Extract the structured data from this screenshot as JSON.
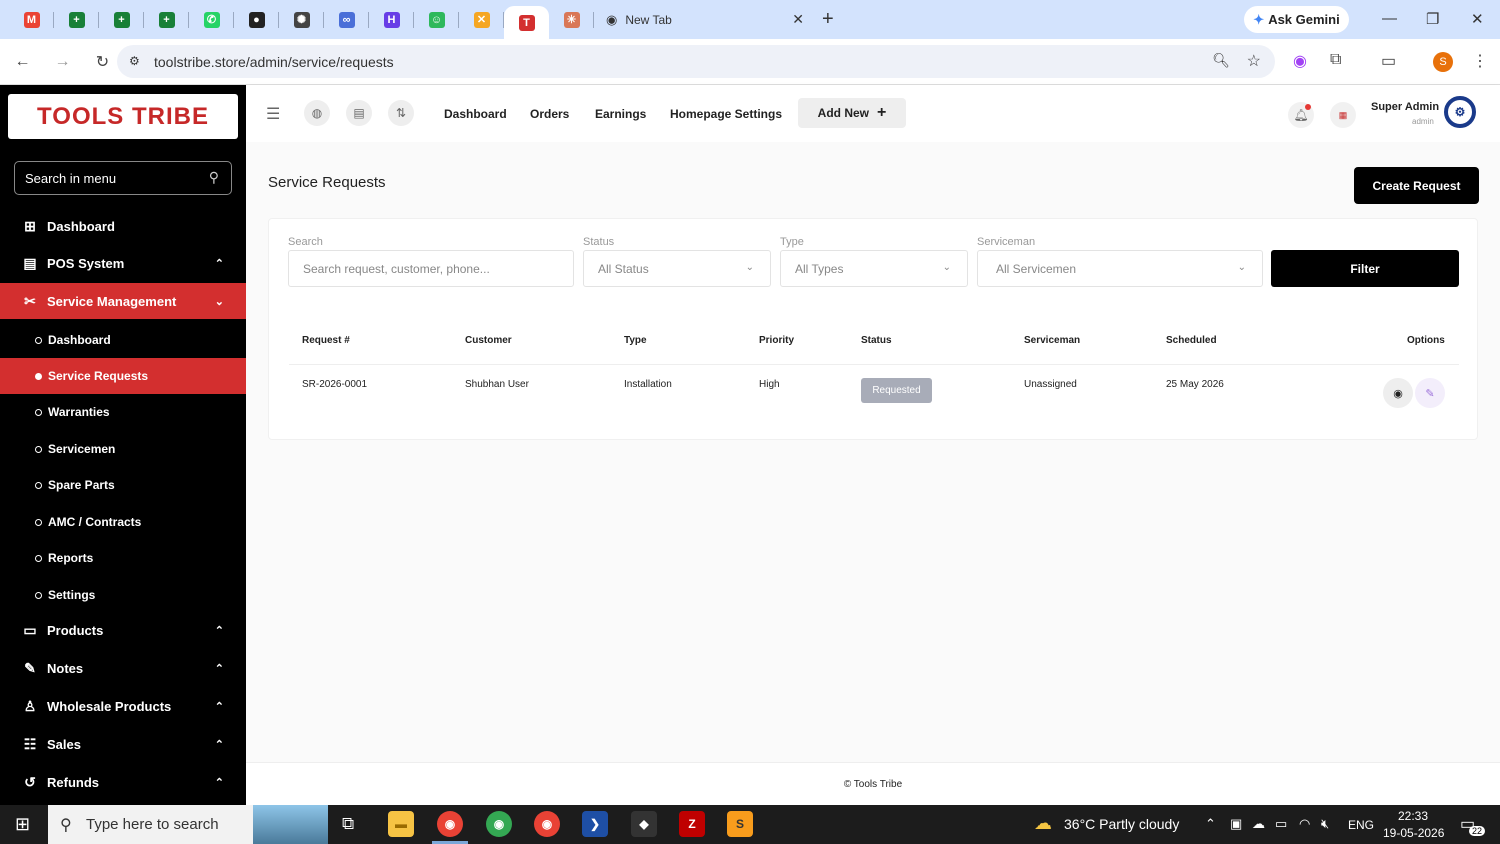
{
  "browser": {
    "tabs": [
      {
        "name": "gmail-tab",
        "glyph": "M",
        "color": "#ea4335"
      },
      {
        "name": "sheets-tab-1",
        "glyph": "+",
        "color": "#188038"
      },
      {
        "name": "sheets-tab-2",
        "glyph": "+",
        "color": "#188038"
      },
      {
        "name": "sheets-tab-3",
        "glyph": "+",
        "color": "#188038"
      },
      {
        "name": "whatsapp-tab",
        "glyph": "✆",
        "color": "#25d366"
      },
      {
        "name": "github-tab",
        "glyph": "●",
        "color": "#222"
      },
      {
        "name": "chatgpt-tab",
        "glyph": "✺",
        "color": "#444"
      },
      {
        "name": "copilot-tab",
        "glyph": "∞",
        "color": "#4a6fd8"
      },
      {
        "name": "hostinger-tab",
        "glyph": "H",
        "color": "#673de6"
      },
      {
        "name": "green-tab",
        "glyph": "☺",
        "color": "#2eb85c"
      },
      {
        "name": "x-tab",
        "glyph": "✕",
        "color": "#f5a623"
      },
      {
        "name": "toolstribe-tab",
        "glyph": "T",
        "color": "#d32f2f"
      },
      {
        "name": "claude-tab",
        "glyph": "✳",
        "color": "#d97757"
      }
    ],
    "new_tab_label": "New Tab",
    "ask_gemini": "Ask Gemini",
    "url": "toolstribe.store/admin/service/requests",
    "profile_initial": "S"
  },
  "brand": {
    "logo_text": "TOOLS TRIBE",
    "accent": "#d32f2f"
  },
  "sidebar": {
    "search_placeholder": "Search in menu",
    "items": [
      {
        "label": "Dashboard",
        "icon": "grid-icon"
      },
      {
        "label": "POS System",
        "icon": "pos-icon"
      },
      {
        "label": "Service Management",
        "icon": "tools-icon"
      },
      {
        "label": "Products",
        "icon": "box-icon"
      },
      {
        "label": "Notes",
        "icon": "notes-icon"
      },
      {
        "label": "Wholesale Products",
        "icon": "wholesale-icon"
      },
      {
        "label": "Sales",
        "icon": "sales-icon"
      },
      {
        "label": "Refunds",
        "icon": "refund-icon"
      }
    ],
    "subitems": [
      "Dashboard",
      "Service Requests",
      "Warranties",
      "Servicemen",
      "Spare Parts",
      "AMC / Contracts",
      "Reports",
      "Settings"
    ]
  },
  "topnav": {
    "links": [
      "Dashboard",
      "Orders",
      "Earnings",
      "Homepage Settings"
    ],
    "add_new": "Add New",
    "user_name": "Super Admin",
    "user_role": "admin"
  },
  "page": {
    "title": "Service Requests",
    "create_button": "Create Request",
    "filters": {
      "search_label": "Search",
      "search_placeholder": "Search request, customer, phone...",
      "status_label": "Status",
      "status_value": "All Status",
      "type_label": "Type",
      "type_value": "All Types",
      "serviceman_label": "Serviceman",
      "serviceman_value": "All Servicemen",
      "filter_button": "Filter"
    },
    "table": {
      "headers": [
        "Request #",
        "Customer",
        "Type",
        "Priority",
        "Status",
        "Serviceman",
        "Scheduled",
        "Options"
      ],
      "rows": [
        {
          "request": "SR-2026-0001",
          "customer": "Shubhan User",
          "type": "Installation",
          "priority": "High",
          "status": "Requested",
          "serviceman": "Unassigned",
          "scheduled": "25 May 2026"
        }
      ]
    },
    "footer": "© Tools Tribe"
  },
  "taskbar": {
    "search_placeholder": "Type here to search",
    "weather": "36°C  Partly cloudy",
    "lang": "ENG",
    "time": "22:33",
    "date": "19-05-2026",
    "notif_count": "22"
  }
}
